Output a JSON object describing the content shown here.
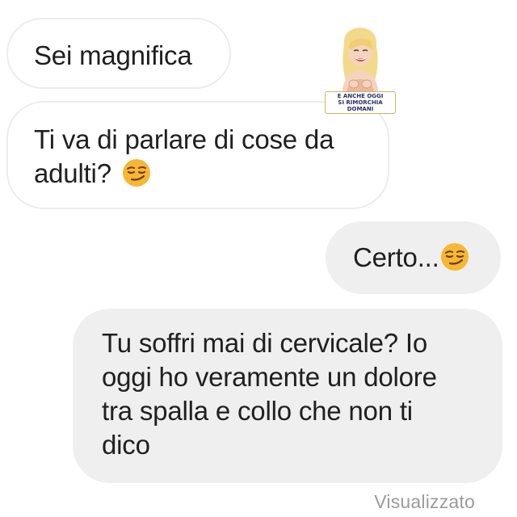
{
  "chat": {
    "messages": [
      {
        "direction": "received",
        "lines": [
          "Sei magnifica"
        ],
        "emoji": ""
      },
      {
        "direction": "received",
        "lines": [
          "Ti va di parlare di cose da",
          "adulti?"
        ],
        "emoji": "smirking-face-emoji"
      },
      {
        "direction": "sent",
        "lines": [
          "Certo..."
        ],
        "emoji": "smirking-face-emoji"
      },
      {
        "direction": "sent",
        "lines": [
          "Tu soffri mai di cervicale? Io",
          "oggi ho veramente un dolore",
          "tra spalla e collo che non ti",
          "dico"
        ],
        "emoji": ""
      }
    ],
    "status": "Visualizzato"
  },
  "watermark": {
    "caption_line1": "E ANCHE OGGI",
    "caption_line2": "SI RIMORCHIA DOMANI"
  },
  "colors": {
    "received_bubble": "#ffffff",
    "received_border": "#ececec",
    "sent_bubble": "#efefef",
    "text": "#1f1f1f",
    "status_text": "#9b9b9b",
    "emoji_face": "#f7b733"
  }
}
